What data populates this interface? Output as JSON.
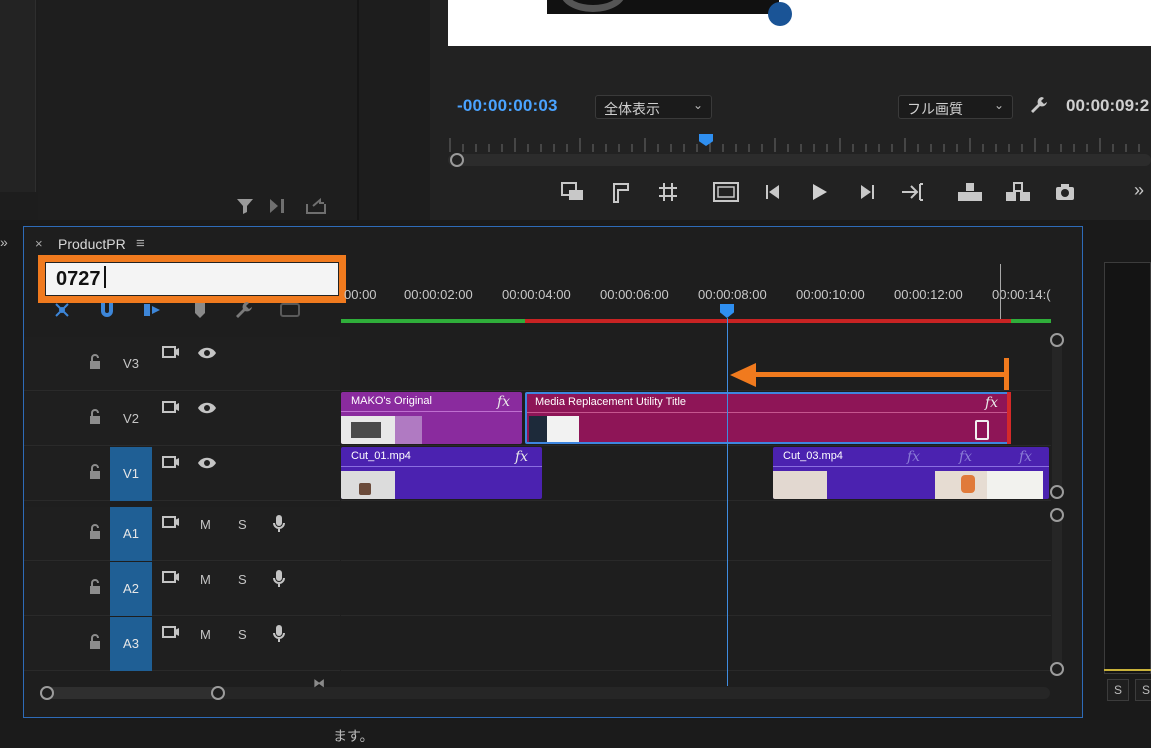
{
  "program_monitor": {
    "current_timecode": "-00:00:00:03",
    "zoom_value": "全体表示",
    "quality_value": "フル画質",
    "duration_timecode": "00:00:09:2",
    "icons": [
      "wrench-icon",
      "mark-in-icon",
      "mark-out-icon",
      "safe-margins-icon",
      "crop-icon",
      "step-back-icon",
      "play-icon",
      "step-forward-icon",
      "go-to-out-icon",
      "lift-icon",
      "extract-icon",
      "camera-icon",
      "more-icon"
    ]
  },
  "left_panel": {
    "icons": [
      "filter-icon",
      "insert-icon",
      "export-icon"
    ]
  },
  "timeline": {
    "close_glyph": "×",
    "title": "ProductPR",
    "menu_glyph": "≡",
    "timecode_input": "0727",
    "ruler_labels": [
      "00:00",
      "00:00:02:00",
      "00:00:04:00",
      "00:00:06:00",
      "00:00:08:00",
      "00:00:10:00",
      "00:00:12:00",
      "00:00:14:("
    ],
    "tracks": [
      {
        "name": "V3",
        "type": "video"
      },
      {
        "name": "V2",
        "type": "video"
      },
      {
        "name": "V1",
        "type": "video",
        "active": true
      },
      {
        "name": "A1",
        "type": "audio",
        "active": true
      },
      {
        "name": "A2",
        "type": "audio",
        "active": true
      },
      {
        "name": "A3",
        "type": "audio",
        "active": true
      }
    ],
    "audio_buttons": {
      "mute": "M",
      "solo": "S"
    },
    "clips": {
      "mako": {
        "label": "MAKO's Original",
        "fx": "fx"
      },
      "media": {
        "label": "Media Replacement Utility Title",
        "fx": "fx"
      },
      "cut01": {
        "label": "Cut_01.mp4",
        "fx": "fx"
      },
      "cut03": {
        "label": "Cut_03.mp4",
        "fx": "fx"
      }
    },
    "colors": {
      "accent": "#2f8ff0",
      "annotation": "#f07a1e",
      "video_clip": "#4b22b0",
      "graphic_clip": "#8e1557",
      "title_clip": "#8a2b9e"
    }
  },
  "right_strip": {
    "buttons": [
      "S",
      "S"
    ]
  },
  "status_bar": {
    "text": "ます。"
  },
  "expander": "»"
}
